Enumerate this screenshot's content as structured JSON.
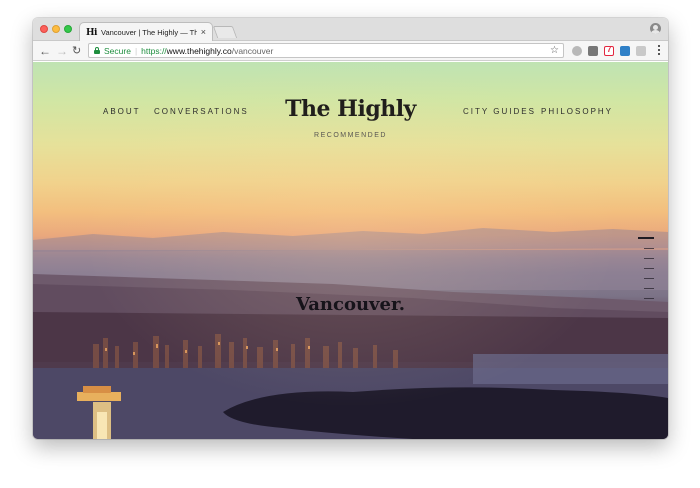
{
  "browser": {
    "tab": {
      "favicon_text": "Hi",
      "title": "Vancouver | The Highly — The",
      "close_glyph": "×"
    },
    "toolbar": {
      "back_glyph": "←",
      "forward_glyph": "→",
      "reload_glyph": "↻",
      "secure_label": "Secure",
      "url_scheme": "https://",
      "url_host": "www.thehighly.co",
      "url_path": "/vancouver",
      "bookmark_glyph": "☆"
    },
    "icons": [
      "close-icon",
      "new-tab-icon",
      "profile-icon",
      "back-icon",
      "forward-icon",
      "reload-icon",
      "lock-icon",
      "star-icon",
      "extension-icon",
      "menu-icon"
    ]
  },
  "site": {
    "nav_left": [
      "ABOUT",
      "CONVERSATIONS"
    ],
    "nav_right": [
      "CITY GUIDES",
      "PHILOSOPHY"
    ],
    "logo": "The Highly",
    "tagline": "RECOMMENDED",
    "city_title": "Vancouver."
  },
  "colors": {
    "accent_secure": "#1e8e3e",
    "sky_top": "#bfe3b3",
    "sky_horizon": "#f3be7e",
    "water": "#8a7d90"
  }
}
